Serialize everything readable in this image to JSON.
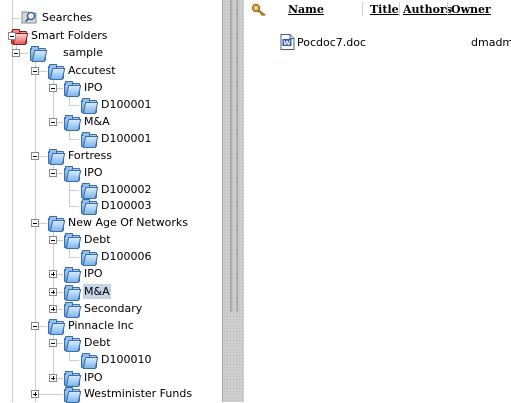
{
  "tree": {
    "items": [
      {
        "id": "searches",
        "label": "Searches",
        "icon": "search-icon",
        "toggle": null
      },
      {
        "id": "smart-folders",
        "label": "Smart Folders",
        "icon": "smart-folder-icon",
        "toggle": "minus"
      },
      {
        "id": "sample",
        "label": "sample",
        "icon": "folder-icon",
        "toggle": "minus"
      },
      {
        "id": "accutest",
        "label": "Accutest",
        "icon": "folder-icon",
        "toggle": "minus"
      },
      {
        "id": "accutest-ipo",
        "label": "IPO",
        "icon": "folder-icon",
        "toggle": "minus"
      },
      {
        "id": "accutest-ipo-d100001",
        "label": "D100001",
        "icon": "folder-icon",
        "toggle": null
      },
      {
        "id": "accutest-ma",
        "label": "M&A",
        "icon": "folder-icon",
        "toggle": "minus"
      },
      {
        "id": "accutest-ma-d100001",
        "label": "D100001",
        "icon": "folder-icon",
        "toggle": null
      },
      {
        "id": "fortress",
        "label": "Fortress",
        "icon": "folder-icon",
        "toggle": "minus"
      },
      {
        "id": "fortress-ipo",
        "label": "IPO",
        "icon": "folder-icon",
        "toggle": "minus"
      },
      {
        "id": "fortress-ipo-d100002",
        "label": "D100002",
        "icon": "folder-icon",
        "toggle": null
      },
      {
        "id": "fortress-ipo-d100003",
        "label": "D100003",
        "icon": "folder-icon",
        "toggle": null
      },
      {
        "id": "nan",
        "label": "New Age Of Networks",
        "icon": "folder-icon",
        "toggle": "minus"
      },
      {
        "id": "nan-debt",
        "label": "Debt",
        "icon": "folder-icon",
        "toggle": "minus"
      },
      {
        "id": "nan-debt-d100006",
        "label": "D100006",
        "icon": "folder-icon",
        "toggle": null
      },
      {
        "id": "nan-ipo",
        "label": "IPO",
        "icon": "folder-icon",
        "toggle": "plus"
      },
      {
        "id": "nan-ma",
        "label": "M&A",
        "icon": "folder-icon",
        "toggle": "plus",
        "selected": true
      },
      {
        "id": "nan-secondary",
        "label": "Secondary",
        "icon": "folder-icon",
        "toggle": "plus"
      },
      {
        "id": "pinnacle",
        "label": "Pinnacle Inc",
        "icon": "folder-icon",
        "toggle": "minus"
      },
      {
        "id": "pinnacle-debt",
        "label": "Debt",
        "icon": "folder-icon",
        "toggle": "minus"
      },
      {
        "id": "pinnacle-debt-d100010",
        "label": "D100010",
        "icon": "folder-icon",
        "toggle": null
      },
      {
        "id": "pinnacle-ipo",
        "label": "IPO",
        "icon": "folder-icon",
        "toggle": "plus"
      },
      {
        "id": "westminister",
        "label": "Westminister Funds",
        "icon": "folder-icon",
        "toggle": "plus"
      }
    ]
  },
  "list": {
    "header": {
      "key_icon": "key-icon",
      "name": "Name",
      "title": "Title",
      "authors": "Authors",
      "owner": "Owner"
    },
    "rows": [
      {
        "icon": "word-document-icon",
        "name": "Pocdoc7.doc",
        "title": "",
        "authors": "",
        "owner": "dmadmi"
      }
    ]
  },
  "colors": {
    "selection": "#c6d4e8",
    "folder": "#5f9fd8",
    "smart_folder": "#d23a3a"
  }
}
